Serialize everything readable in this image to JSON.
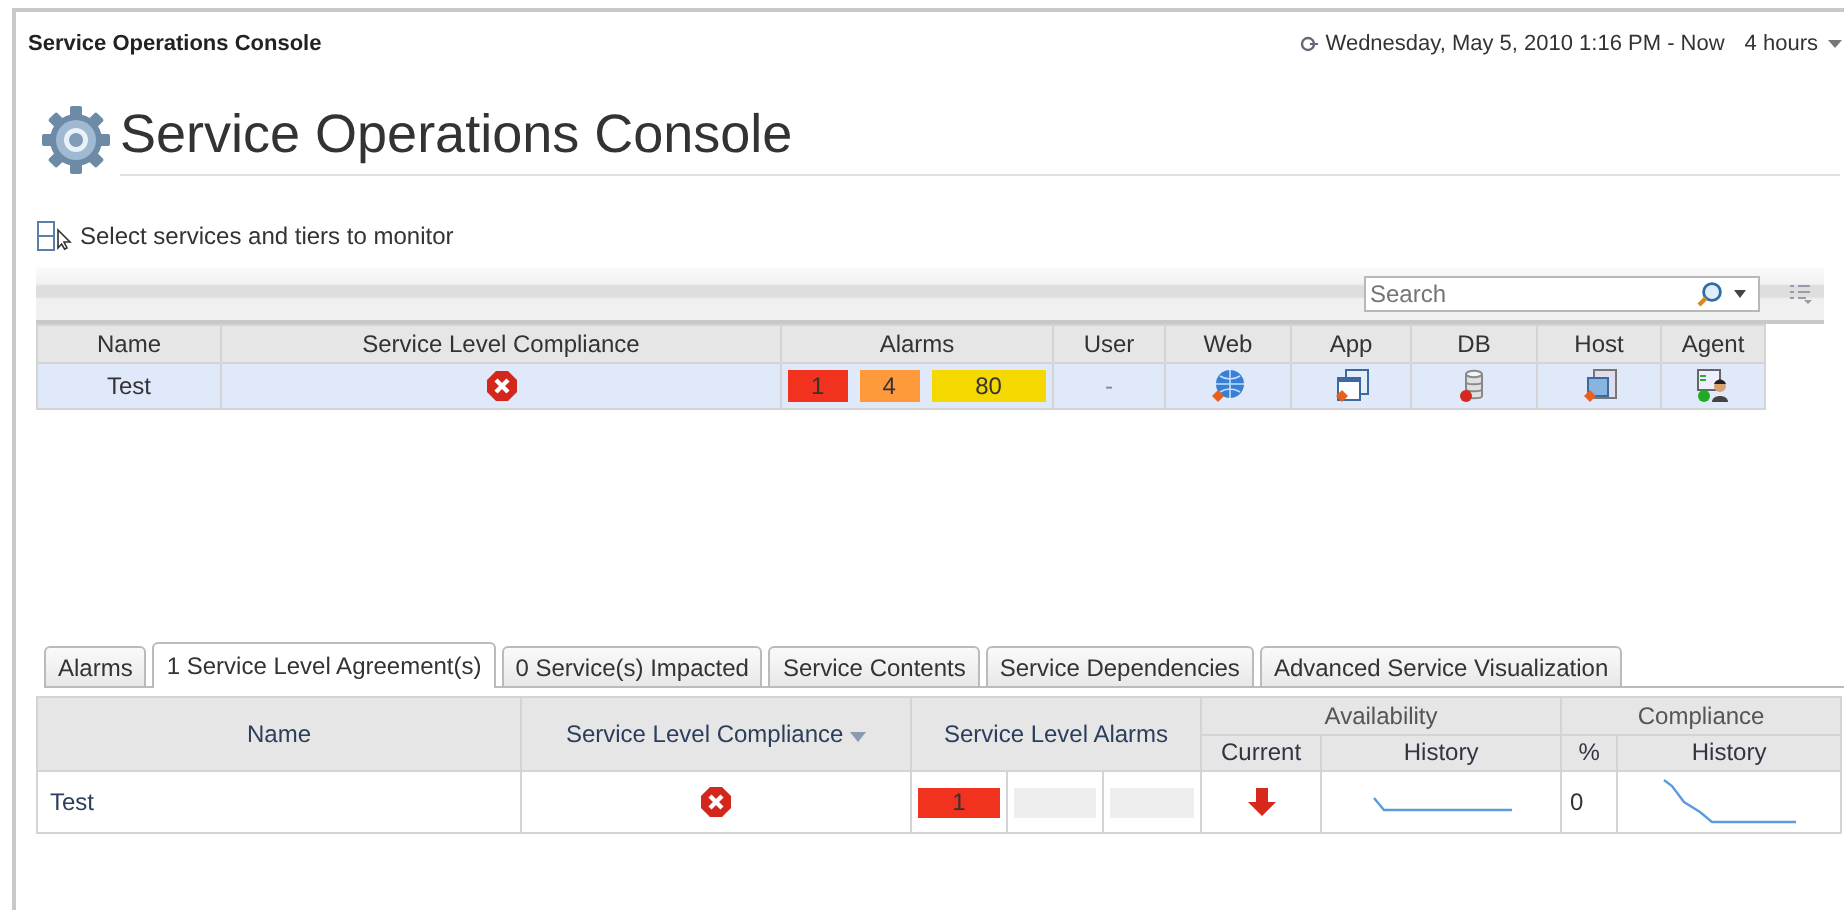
{
  "header": {
    "title": "Service Operations Console",
    "date_range": "Wednesday, May 5, 2010  1:16 PM - Now",
    "duration": "4 hours"
  },
  "page_title": "Service Operations Console",
  "select_link": "Select services and tiers to monitor",
  "search": {
    "placeholder": "Search"
  },
  "services_table": {
    "columns": [
      {
        "label": "Name",
        "kind": "name"
      },
      {
        "label": "Service Level Compliance",
        "kind": "compliance"
      },
      {
        "label": "Alarms",
        "kind": "alarms"
      },
      {
        "label": "User",
        "kind": "user"
      },
      {
        "label": "Web",
        "kind": "web"
      },
      {
        "label": "App",
        "kind": "app"
      },
      {
        "label": "DB",
        "kind": "db"
      },
      {
        "label": "Host",
        "kind": "host"
      },
      {
        "label": "Agent",
        "kind": "agent"
      }
    ],
    "rows": [
      {
        "name": "Test",
        "selected": true,
        "compliant": false,
        "alarms": [
          {
            "value": "1",
            "color": "#f0321e"
          },
          {
            "value": "4",
            "color": "#ff9a3c"
          },
          {
            "value": "80",
            "color": "#f5d800"
          }
        ],
        "user": "-"
      }
    ]
  },
  "tabs": [
    {
      "label": "Alarms",
      "selected": false
    },
    {
      "label": "1 Service Level Agreement(s)",
      "selected": true
    },
    {
      "label": "0 Service(s) Impacted",
      "selected": false
    },
    {
      "label": "Service Contents",
      "selected": false
    },
    {
      "label": "Service Dependencies",
      "selected": false
    },
    {
      "label": "Advanced Service Visualization",
      "selected": false
    }
  ],
  "sla_table": {
    "columns": {
      "name": "Name",
      "compliance": "Service Level Compliance",
      "alarms": "Service Level Alarms",
      "availability": "Availability",
      "current": "Current",
      "availability_history": "History",
      "compliance_group": "Compliance",
      "percent": "%",
      "compliance_history": "History"
    },
    "rows": [
      {
        "name": "Test",
        "compliant": false,
        "alarms": [
          {
            "value": "1",
            "color": "#f0321e"
          },
          {
            "color": "#eeeeee"
          },
          {
            "color": "#eeeeee"
          }
        ],
        "available": false,
        "percent": "0"
      }
    ]
  }
}
